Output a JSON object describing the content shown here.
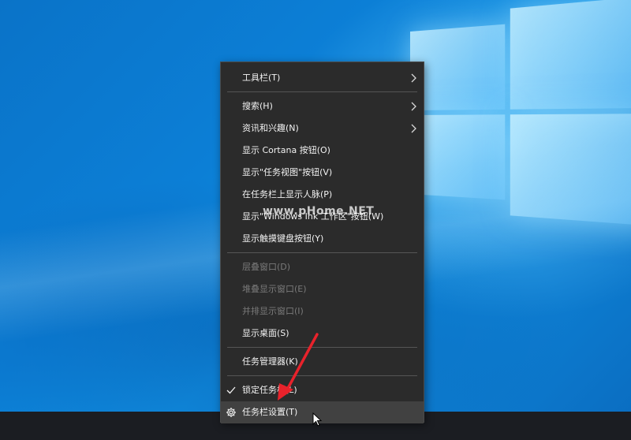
{
  "menu": {
    "items": [
      {
        "label": "工具栏(T)",
        "submenu": true,
        "enabled": true
      },
      {
        "label": "搜索(H)",
        "submenu": true,
        "enabled": true
      },
      {
        "label": "资讯和兴趣(N)",
        "submenu": true,
        "enabled": true
      },
      {
        "label": "显示 Cortana 按钮(O)",
        "enabled": true
      },
      {
        "label": "显示\"任务视图\"按钮(V)",
        "enabled": true
      },
      {
        "label": "在任务栏上显示人脉(P)",
        "enabled": true
      },
      {
        "label": "显示\"Windows Ink 工作区\"按钮(W)",
        "enabled": true
      },
      {
        "label": "显示触摸键盘按钮(Y)",
        "enabled": true
      },
      {
        "label": "层叠窗口(D)",
        "enabled": false
      },
      {
        "label": "堆叠显示窗口(E)",
        "enabled": false
      },
      {
        "label": "并排显示窗口(I)",
        "enabled": false
      },
      {
        "label": "显示桌面(S)",
        "enabled": true
      },
      {
        "label": "任务管理器(K)",
        "enabled": true
      },
      {
        "label": "锁定任务栏(L)",
        "checked": true,
        "enabled": true
      },
      {
        "label": "任务栏设置(T)",
        "icon": "gear-icon",
        "enabled": true,
        "highlighted": true
      }
    ]
  },
  "watermark": "www.pHome.NET",
  "colors": {
    "menu_bg": "#2b2b2b",
    "menu_text": "#f2f2f2",
    "menu_disabled": "#7a7a7a",
    "annotation": "#e8222b",
    "taskbar": "#1b1d22"
  }
}
